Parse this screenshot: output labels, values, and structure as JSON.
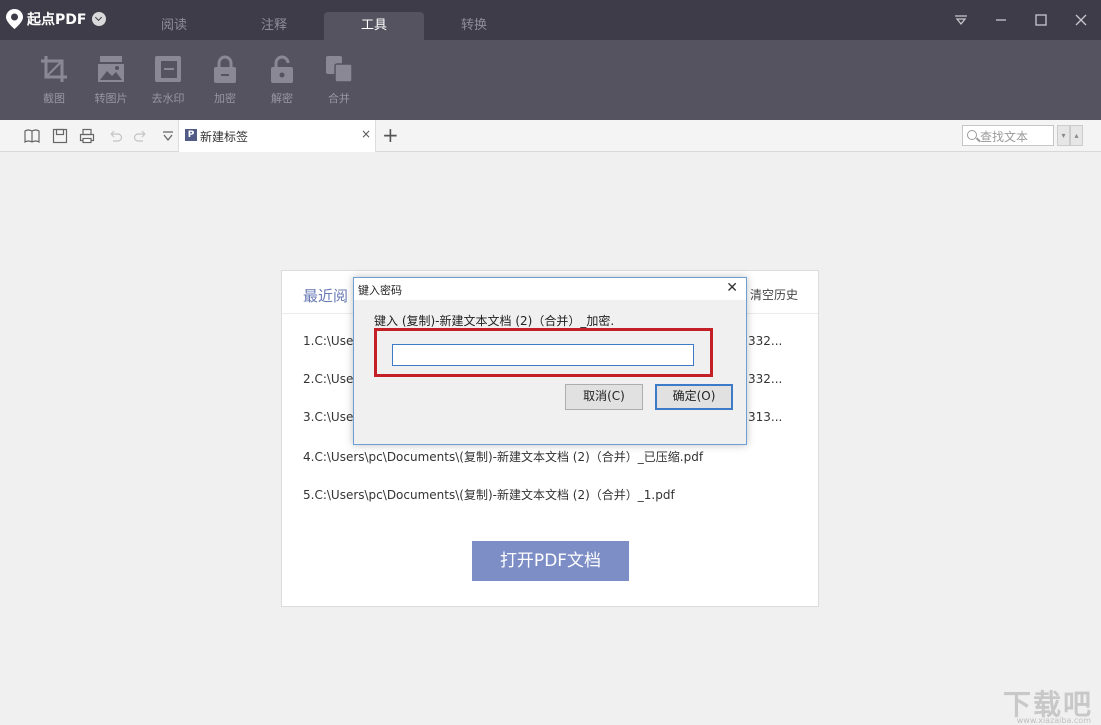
{
  "app": {
    "name": "起点PDF"
  },
  "tabs": [
    "阅读",
    "注释",
    "工具",
    "转换"
  ],
  "active_tab": "工具",
  "ribbon": {
    "tools": [
      {
        "label": "截图",
        "icon": "crop-icon"
      },
      {
        "label": "转图片",
        "icon": "image-convert-icon"
      },
      {
        "label": "去水印",
        "icon": "remove-watermark-icon"
      },
      {
        "label": "加密",
        "icon": "lock-icon"
      },
      {
        "label": "解密",
        "icon": "unlock-icon"
      },
      {
        "label": "合并",
        "icon": "merge-icon"
      }
    ]
  },
  "toolbar": {
    "doc_tab_label": "新建标签",
    "doc_tab_badge": "P",
    "close_glyph": "×",
    "add_glyph": "+",
    "search_placeholder": "查找文本"
  },
  "recent": {
    "title": "最近阅",
    "clear_label": "清空历史",
    "items": [
      {
        "start": "1.C:\\Use",
        "end": "332..."
      },
      {
        "start": "2.C:\\Use",
        "end": "332..."
      },
      {
        "start": "3.C:\\Use",
        "end": "313..."
      },
      {
        "start": "4.C:\\Users\\pc\\Documents\\(复制)-新建文本文档 (2)（合并）_已压缩.pdf",
        "end": ""
      },
      {
        "start": "5.C:\\Users\\pc\\Documents\\(复制)-新建文本文档 (2)（合并）_1.pdf",
        "end": ""
      }
    ],
    "open_button": "打开PDF文档"
  },
  "dialog": {
    "title": "键入密码",
    "prompt": "键入 (复制)-新建文本文档 (2)（合并）_加密.",
    "password_value": "",
    "cancel_label": "取消(C)",
    "ok_label": "确定(O)",
    "close_glyph": "✕"
  },
  "watermark": {
    "text": "下载吧",
    "url": "www.xiazaiba.com"
  },
  "colors": {
    "titlebar": "#3e3c48",
    "ribbon": "#55535f",
    "accent": "#7d8ec6",
    "highlight": "#c22026"
  }
}
